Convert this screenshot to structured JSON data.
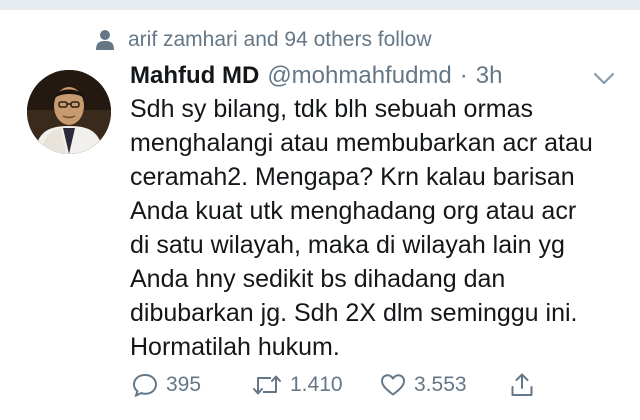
{
  "social_context": {
    "text": "arif zamhari and 94 others follow",
    "icon": "person-icon"
  },
  "tweet": {
    "display_name": "Mahfud MD",
    "handle": "@mohmahfudmd",
    "separator": "·",
    "timestamp": "3h",
    "text_lines": [
      "Sdh sy bilang, tdk blh sebuah ormas",
      "menghalangi atau membubarkan acr atau",
      "ceramah2. Mengapa? Krn kalau barisan",
      "Anda kuat utk menghadang org atau acr",
      "di satu wilayah, maka di wilayah lain yg",
      "Anda hny sedikit bs dihadang dan",
      "dibubarkan jg. Sdh 2X dlm seminggu ini.",
      "Hormatilah hukum."
    ]
  },
  "actions": {
    "reply_count": "395",
    "retweet_count": "1.410",
    "like_count": "3.553"
  },
  "colors": {
    "text": "#14171a",
    "secondary": "#657786",
    "divider": "#e6ecf0"
  }
}
